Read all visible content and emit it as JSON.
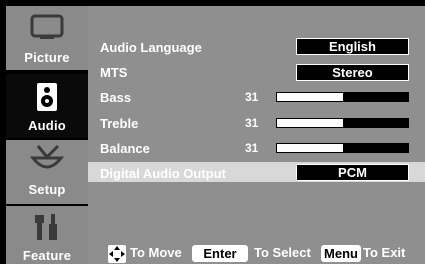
{
  "tabs": [
    {
      "label": "Picture",
      "icon": "monitor-icon"
    },
    {
      "label": "Audio",
      "icon": "speaker-icon"
    },
    {
      "label": "Setup",
      "icon": "antenna-icon"
    },
    {
      "label": "Feature",
      "icon": "tools-icon"
    }
  ],
  "menu": {
    "audio_language": {
      "label": "Audio Language",
      "value": "English"
    },
    "mts": {
      "label": "MTS",
      "value": "Stereo"
    },
    "bass": {
      "label": "Bass",
      "value": "31",
      "level": 0.5
    },
    "treble": {
      "label": "Treble",
      "value": "31",
      "level": 0.5
    },
    "balance": {
      "label": "Balance",
      "value": "31",
      "level": 0.5
    },
    "digital_audio_output": {
      "label": "Digital Audio Output",
      "value": "PCM"
    }
  },
  "footer": {
    "move_text": "To Move",
    "enter_key": "Enter",
    "select_text": "To Select",
    "menu_key": "Menu",
    "exit_text": "To Exit"
  }
}
